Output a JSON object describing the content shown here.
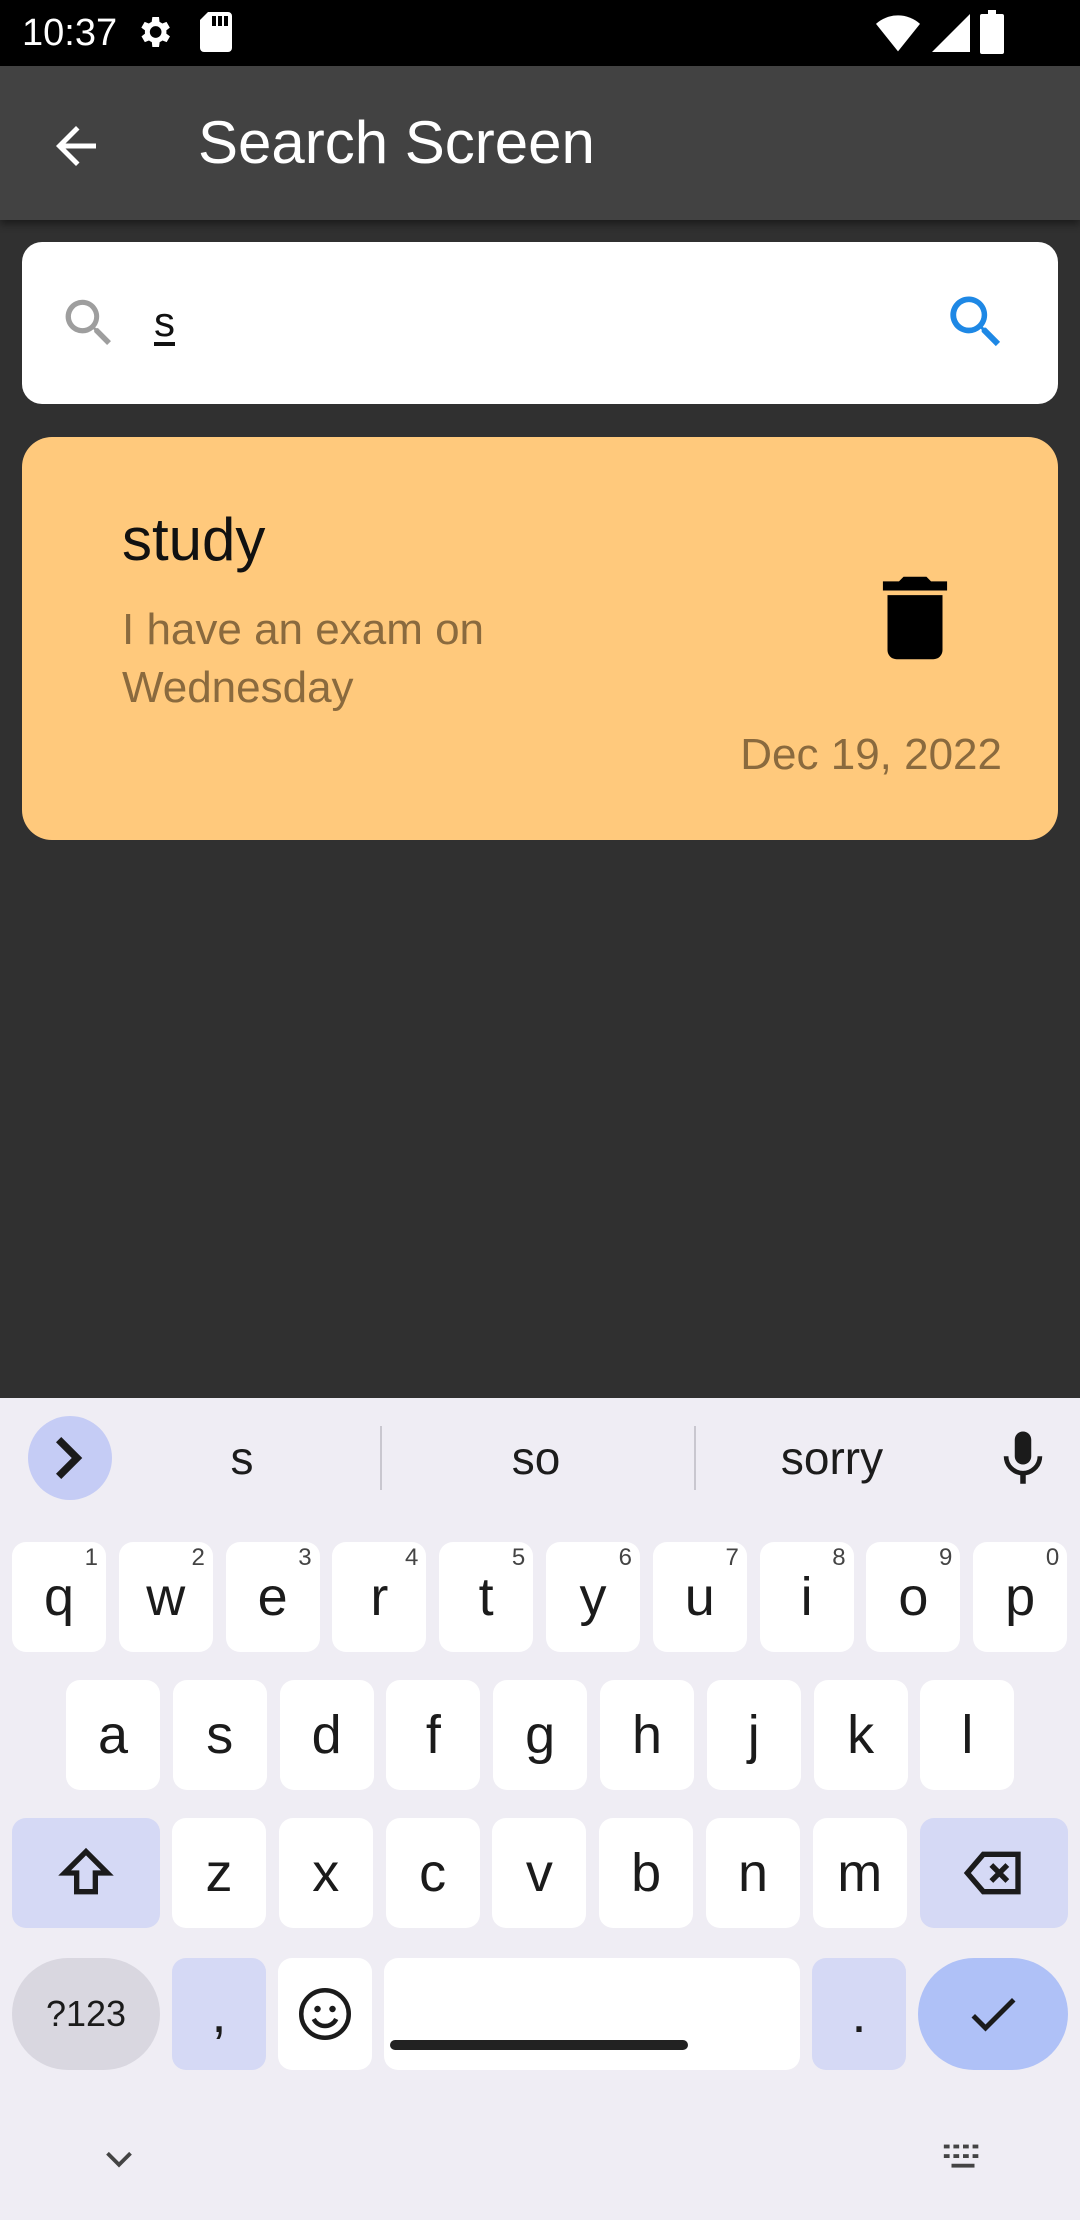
{
  "status_bar": {
    "time": "10:37"
  },
  "app_bar": {
    "title": "Search Screen"
  },
  "search": {
    "value": "s"
  },
  "results": [
    {
      "title": "study",
      "description": "I have an exam on Wednesday",
      "date": "Dec 19, 2022",
      "color": "#FFC97C"
    }
  ],
  "keyboard": {
    "suggestions": [
      "s",
      "so",
      "sorry"
    ],
    "row1": [
      {
        "key": "q",
        "hint": "1"
      },
      {
        "key": "w",
        "hint": "2"
      },
      {
        "key": "e",
        "hint": "3"
      },
      {
        "key": "r",
        "hint": "4"
      },
      {
        "key": "t",
        "hint": "5"
      },
      {
        "key": "y",
        "hint": "6"
      },
      {
        "key": "u",
        "hint": "7"
      },
      {
        "key": "i",
        "hint": "8"
      },
      {
        "key": "o",
        "hint": "9"
      },
      {
        "key": "p",
        "hint": "0"
      }
    ],
    "row2": [
      "a",
      "s",
      "d",
      "f",
      "g",
      "h",
      "j",
      "k",
      "l"
    ],
    "row3": [
      "z",
      "x",
      "c",
      "v",
      "b",
      "n",
      "m"
    ],
    "symbols_label": "?123",
    "comma_label": ",",
    "period_label": "."
  },
  "colors": {
    "app_bar": "#424242",
    "background": "#303030",
    "accent": "#1E88E5",
    "card": "#FFC97C"
  }
}
